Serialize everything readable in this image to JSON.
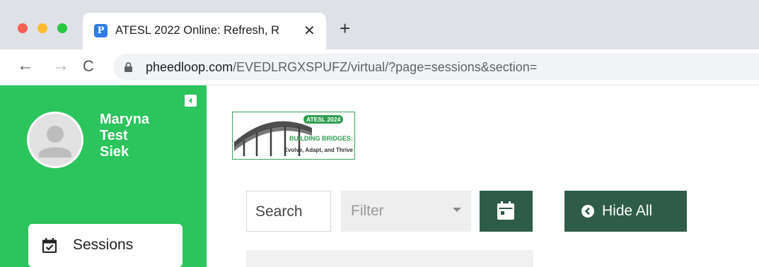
{
  "browser": {
    "tab": {
      "title": "ATESL 2022 Online: Refresh, R",
      "close_glyph": "✕",
      "favicon_letter": "P"
    },
    "new_tab_glyph": "+",
    "nav": {
      "back": "←",
      "forward": "→",
      "reload": "C"
    },
    "address": {
      "host": "pheedloop.com",
      "path": "/EVEDLRGXSPUFZ/virtual/?page=sessions&section="
    },
    "traffic_colors": {
      "close": "#ff5f57",
      "minimize": "#febc2e",
      "zoom": "#28c840"
    }
  },
  "sidebar": {
    "user": {
      "first": "Maryna",
      "middle": "Test",
      "last": "Siek"
    },
    "items": [
      {
        "label": "Sessions",
        "icon": "calendar-check-icon"
      }
    ],
    "accent": "#2bc45d"
  },
  "logo": {
    "badge": "ATESL 2024",
    "line1": "BUILDING BRIDGES:",
    "line2": "Evolve, Adapt, and Thrive"
  },
  "controls": {
    "search_label": "Search",
    "filter_label": "Filter",
    "hide_all_label": "Hide All",
    "button_color": "#2f5c48"
  }
}
